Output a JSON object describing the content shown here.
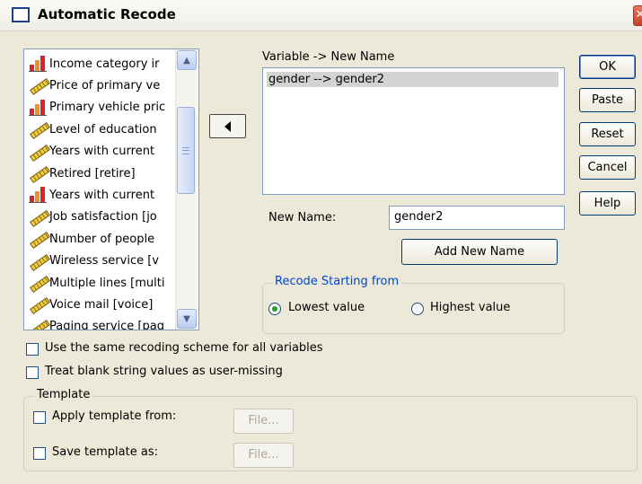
{
  "title": "Automatic Recode",
  "variables": [
    {
      "label": "Income category ir",
      "icon": "ordinal-icon"
    },
    {
      "label": "Price of primary ve",
      "icon": "scale-icon"
    },
    {
      "label": "Primary vehicle pric",
      "icon": "ordinal-icon"
    },
    {
      "label": "Level of education",
      "icon": "scale-icon"
    },
    {
      "label": "Years with current",
      "icon": "scale-icon"
    },
    {
      "label": "Retired [retire]",
      "icon": "scale-icon"
    },
    {
      "label": "Years with current",
      "icon": "ordinal-icon"
    },
    {
      "label": "Job satisfaction [jo",
      "icon": "scale-icon"
    },
    {
      "label": "Number of people",
      "icon": "scale-icon"
    },
    {
      "label": "Wireless service [v",
      "icon": "scale-icon"
    },
    {
      "label": "Multiple lines [multi",
      "icon": "scale-icon"
    },
    {
      "label": "Voice mail [voice]",
      "icon": "scale-icon"
    },
    {
      "label": "Paging service [pag",
      "icon": "scale-icon"
    }
  ],
  "mapping": {
    "header": "Variable -> New Name",
    "selected": "gender --> gender2"
  },
  "new_name": {
    "label": "New Name:",
    "value": "gender2",
    "add_button": "Add New Name"
  },
  "recode": {
    "title": "Recode Starting from",
    "lowest": "Lowest value",
    "highest": "Highest value",
    "selected": "lowest"
  },
  "options": {
    "same_scheme": "Use the same recoding scheme for all variables",
    "blank_missing": "Treat blank string values as user-missing"
  },
  "template": {
    "title": "Template",
    "apply": "Apply template from:",
    "save": "Save template as:",
    "file_button": "File..."
  },
  "buttons": {
    "ok": "OK",
    "paste": "Paste",
    "reset": "Reset",
    "cancel": "Cancel",
    "help": "Help"
  }
}
